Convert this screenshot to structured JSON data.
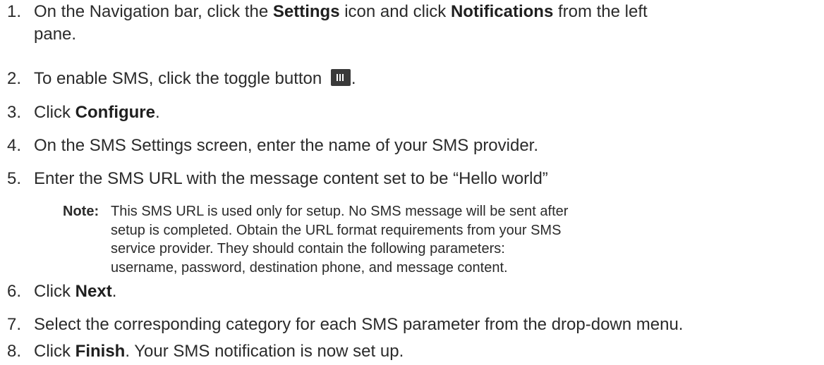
{
  "steps": [
    {
      "number": "1.",
      "parts": [
        "On the Navigation bar, click the ",
        "Settings",
        " icon and click ",
        "Notifications",
        " from the left",
        "pane."
      ]
    },
    {
      "number": "2.",
      "parts": [
        "To enable SMS, click the toggle button ",
        "."
      ]
    },
    {
      "number": "3.",
      "parts": [
        "Click ",
        "Configure",
        "."
      ]
    },
    {
      "number": "4.",
      "parts": [
        "On the SMS Settings screen, enter the name of your SMS provider."
      ]
    },
    {
      "number": "5.",
      "parts": [
        "Enter the SMS URL with the message content set to be “Hello world”"
      ]
    },
    {
      "number": "6.",
      "parts": [
        "Click ",
        "Next",
        "."
      ]
    },
    {
      "number": "7.",
      "parts": [
        "Select the corresponding category for each SMS parameter from the drop-down menu."
      ]
    },
    {
      "number": "8.",
      "parts": [
        "Click ",
        "Finish",
        ". Your SMS notification is now set up."
      ]
    }
  ],
  "note": {
    "label": "Note:",
    "lines": [
      "This SMS URL is used only for setup. No SMS message will be sent after",
      "setup is completed. Obtain the URL format requirements from your SMS",
      "service provider. They should contain the following parameters:",
      "username, password, destination phone, and message content."
    ]
  },
  "icons": {
    "toggle": "toggle-button-icon",
    "toggle_color": "#3a3a3a"
  }
}
